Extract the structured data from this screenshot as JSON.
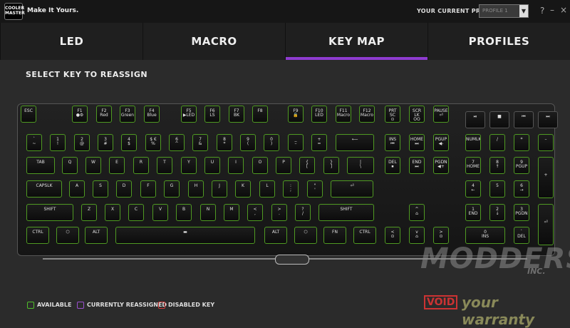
{
  "header": {
    "logo_text": "COOLER MASTER",
    "tagline": "Make It Yours.",
    "profile_label": "YOUR CURRENT PROFILE",
    "profile_value": "PROFILE 1",
    "help": "?",
    "minimize": "–",
    "close": "×"
  },
  "tabs": [
    {
      "label": "LED"
    },
    {
      "label": "MACRO"
    },
    {
      "label": "KEY MAP",
      "active": true
    },
    {
      "label": "PROFILES"
    }
  ],
  "page_title": "SELECT KEY TO REASSIGN",
  "keys": [
    [
      "ESC",
      "ESC",
      0,
      0,
      22
    ],
    [
      "F1",
      "F1\n●⚙",
      72,
      0,
      22
    ],
    [
      "F2",
      "F2\nRed",
      106,
      0,
      22
    ],
    [
      "F3",
      "F3\nGreen",
      139,
      0,
      22
    ],
    [
      "F4",
      "F4\nBlue",
      173,
      0,
      22
    ],
    [
      "F5",
      "F5\n▶LED",
      225,
      0,
      22
    ],
    [
      "F6",
      "F6\nLS",
      258,
      0,
      22
    ],
    [
      "F7",
      "F7\nBK",
      292,
      0,
      22
    ],
    [
      "F8",
      "F8",
      325,
      0,
      22
    ],
    [
      "F9",
      "F9\n🔒",
      375,
      0,
      22
    ],
    [
      "F10",
      "F10\nLED",
      408,
      0,
      22
    ],
    [
      "F11",
      "F11\nMacro",
      442,
      0,
      22
    ],
    [
      "F12",
      "F12\nMacro",
      475,
      0,
      22
    ],
    [
      "PRTSC",
      "PRT\nSC\n⊙",
      511,
      0,
      22
    ],
    [
      "SCRLK",
      "SCR\nLK\nOO",
      545,
      0,
      22
    ],
    [
      "PAUSE",
      "PAUSE\n⏎",
      579,
      0,
      22
    ],
    [
      "MEDIA-PLAY",
      "⏯",
      624,
      8,
      28
    ],
    [
      "MEDIA-STOP",
      "■",
      658,
      8,
      28
    ],
    [
      "MEDIA-PREV",
      "⏮",
      692,
      8,
      28
    ],
    [
      "MEDIA-NEXT",
      "⏭",
      726,
      8,
      28
    ],
    [
      "~",
      "`\n~",
      8,
      40,
      22
    ],
    [
      "1",
      "1\n!",
      41,
      40,
      22
    ],
    [
      "2",
      "2\n@",
      75,
      40,
      22
    ],
    [
      "3",
      "3\n#",
      108,
      40,
      22
    ],
    [
      "4",
      "4\n$",
      141,
      40,
      22
    ],
    [
      "5",
      "$ €\n%",
      175,
      40,
      22
    ],
    [
      "6",
      "6\n^",
      208,
      40,
      22
    ],
    [
      "7",
      "7\n&",
      241,
      40,
      22
    ],
    [
      "8",
      "8\n*",
      275,
      40,
      22
    ],
    [
      "9",
      "9\n(",
      308,
      40,
      22
    ],
    [
      "0",
      "0\n)",
      341,
      40,
      22
    ],
    [
      "-",
      "_\n–",
      375,
      40,
      22
    ],
    [
      "=",
      "+\n=",
      408,
      40,
      22
    ],
    [
      "BACKSPACE",
      "⟵",
      442,
      40,
      54
    ],
    [
      "INS",
      "INS\n⏮",
      511,
      40,
      22
    ],
    [
      "HOME",
      "HOME\n⏭",
      545,
      40,
      22
    ],
    [
      "PGUP",
      "PGUP\n◀-",
      579,
      40,
      22
    ],
    [
      "NUMLK",
      "NUMLK",
      624,
      40,
      22
    ],
    [
      "/",
      "/",
      658,
      40,
      22
    ],
    [
      "*",
      "*",
      692,
      40,
      22
    ],
    [
      "-num",
      "–",
      726,
      40,
      22
    ],
    [
      "TAB",
      "TAB",
      8,
      72,
      40
    ],
    [
      "Q",
      "Q",
      58,
      72,
      22
    ],
    [
      "W",
      "W",
      91,
      72,
      22
    ],
    [
      "E",
      "E",
      124,
      72,
      22
    ],
    [
      "R",
      "R",
      158,
      72,
      22
    ],
    [
      "T",
      "T",
      191,
      72,
      22
    ],
    [
      "Y",
      "Y",
      225,
      72,
      22
    ],
    [
      "U",
      "U",
      258,
      72,
      22
    ],
    [
      "I",
      "I",
      291,
      72,
      22
    ],
    [
      "O",
      "O",
      325,
      72,
      22
    ],
    [
      "P",
      "P",
      358,
      72,
      22
    ],
    [
      "[",
      "{\n[",
      391,
      72,
      22
    ],
    [
      "]",
      "}\n]",
      425,
      72,
      22
    ],
    [
      "\\",
      "|\n\\",
      458,
      72,
      38
    ],
    [
      "DEL",
      "DEL\n⏹",
      511,
      72,
      22
    ],
    [
      "END",
      "END\n⏭",
      545,
      72,
      22
    ],
    [
      "PGDN",
      "PGDN\n◀+",
      579,
      72,
      22
    ],
    [
      "7num",
      "7\nHOME",
      624,
      72,
      22
    ],
    [
      "8num",
      "8\n↑",
      658,
      72,
      22
    ],
    [
      "9num",
      "9\nPGUP",
      692,
      72,
      22
    ],
    [
      "CAPSLK",
      "CAPSLK",
      8,
      105,
      50
    ],
    [
      "A",
      "A",
      68,
      105,
      22
    ],
    [
      "S",
      "S",
      101,
      105,
      22
    ],
    [
      "D",
      "D",
      134,
      105,
      22
    ],
    [
      "F",
      "F",
      168,
      105,
      22
    ],
    [
      "G",
      "G",
      201,
      105,
      22
    ],
    [
      "H",
      "H",
      235,
      105,
      22
    ],
    [
      "J",
      "J",
      268,
      105,
      22
    ],
    [
      "K",
      "K",
      301,
      105,
      22
    ],
    [
      "L",
      "L",
      335,
      105,
      22
    ],
    [
      ";",
      ":\n;",
      368,
      105,
      22
    ],
    [
      "'",
      "\"\n'",
      402,
      105,
      22
    ],
    [
      "ENTER",
      "⏎",
      435,
      105,
      60
    ],
    [
      "4num",
      "4\n←",
      624,
      105,
      22
    ],
    [
      "5num",
      "5",
      658,
      105,
      22
    ],
    [
      "6num",
      "6\n→",
      692,
      105,
      22
    ],
    [
      "LSHIFT",
      "SHIFT",
      8,
      138,
      66
    ],
    [
      "Z",
      "Z",
      85,
      138,
      22
    ],
    [
      "X",
      "X",
      118,
      138,
      22
    ],
    [
      "C",
      "C",
      151,
      138,
      22
    ],
    [
      "V",
      "V",
      185,
      138,
      22
    ],
    [
      "B",
      "B",
      218,
      138,
      22
    ],
    [
      "N",
      "N",
      252,
      138,
      22
    ],
    [
      "M",
      "M",
      285,
      138,
      22
    ],
    [
      ",",
      "<\n,",
      318,
      138,
      22
    ],
    [
      ".",
      ">\n.",
      352,
      138,
      22
    ],
    [
      "/q",
      "?\n/",
      385,
      138,
      22
    ],
    [
      "RSHIFT",
      "SHIFT",
      418,
      138,
      78
    ],
    [
      "UP",
      "^\n⌂",
      545,
      138,
      22
    ],
    [
      "1num",
      "1\nEND",
      624,
      138,
      22
    ],
    [
      "2num",
      "2\n↓",
      658,
      138,
      22
    ],
    [
      "3num",
      "3\nPGDN",
      692,
      138,
      22
    ],
    [
      "LCTRL",
      "CTRL",
      8,
      170,
      32
    ],
    [
      "LWIN",
      "⬡",
      50,
      170,
      32
    ],
    [
      "LALT",
      "ALT",
      90,
      170,
      32
    ],
    [
      "SPACE",
      "▬",
      133,
      170,
      196
    ],
    [
      "RALT",
      "ALT",
      342,
      170,
      32
    ],
    [
      "RWIN",
      "⬡",
      384,
      170,
      32
    ],
    [
      "FN",
      "FN",
      425,
      170,
      32
    ],
    [
      "RCTRL",
      "CTRL",
      467,
      170,
      32
    ],
    [
      "LEFT",
      "<\n⊙",
      511,
      170,
      22
    ],
    [
      "DOWN",
      "v\n⌂",
      545,
      170,
      22
    ],
    [
      "RIGHT",
      ">\n⊙",
      579,
      170,
      22
    ],
    [
      "0num",
      "0\nINS",
      624,
      170,
      56
    ],
    [
      ".num",
      "`\nDEL",
      692,
      170,
      22
    ]
  ],
  "tall_keys": [
    [
      "+num",
      "+",
      726,
      72,
      22
    ],
    [
      "ENTERnum",
      "⏎",
      726,
      138,
      22
    ]
  ],
  "legend": {
    "available": "AVAILABLE",
    "reassigned": "CURRENTLY REASSIGNED",
    "disabled": "DISABLED KEY",
    "colors": {
      "available": "#4fbf2a",
      "reassigned": "#9b4fd0",
      "disabled": "#d23a3a"
    }
  },
  "watermark": {
    "main": "MODDERS",
    "inc": "INC.",
    "void": "VOID",
    "tagline": "your warranty"
  }
}
